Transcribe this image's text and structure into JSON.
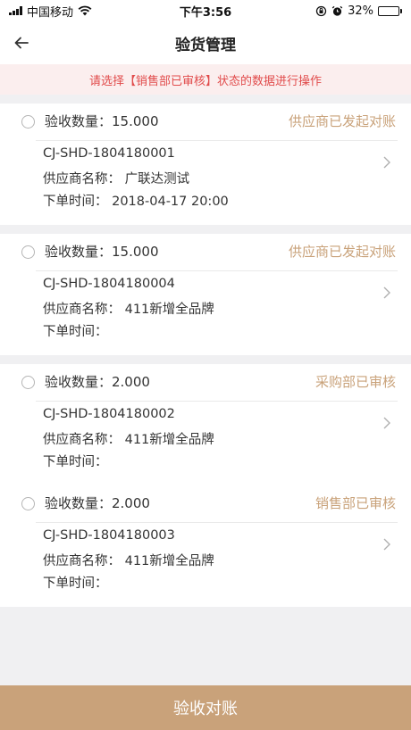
{
  "status_bar": {
    "carrier": "中国移动",
    "time": "下午3:56",
    "battery": "32%",
    "battery_level": 0.32
  },
  "nav": {
    "title": "验货管理",
    "back_icon": "arrow-left-icon"
  },
  "notice": "请选择【销售部已审核】状态的数据进行操作",
  "colors": {
    "accent": "#c9a27a",
    "notice_text": "#e14b4b",
    "notice_bg": "#fbeeee"
  },
  "orders": [
    {
      "qty": "验收数量：15.000",
      "status": "供应商已发起对账",
      "code": "CJ-SHD-1804180001",
      "supplier": "供应商名称：  广联达测试",
      "time": "下单时间：  2018-04-17 20:00"
    },
    {
      "qty": "验收数量：15.000",
      "status": "供应商已发起对账",
      "code": "CJ-SHD-1804180004",
      "supplier": "供应商名称：  411新增全品牌",
      "time": "下单时间："
    },
    {
      "qty": "验收数量：2.000",
      "status": "采购部已审核",
      "code": "CJ-SHD-1804180002",
      "supplier": "供应商名称：  411新增全品牌",
      "time": "下单时间："
    },
    {
      "qty": "验收数量：2.000",
      "status": "销售部已审核",
      "code": "CJ-SHD-1804180003",
      "supplier": "供应商名称：  411新增全品牌",
      "time": "下单时间："
    }
  ],
  "footer": {
    "button_label": "验收对账"
  }
}
